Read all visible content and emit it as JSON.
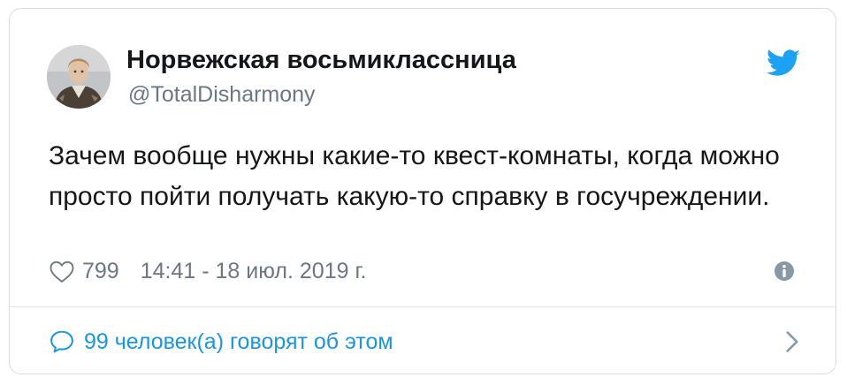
{
  "tweet": {
    "display_name": "Норвежская восьмиклассница",
    "handle": "@TotalDisharmony",
    "text": "Зачем вообще нужны какие-то квест-комнаты, когда можно просто пойти получать какую-то справку в госучреждении.",
    "likes": "799",
    "timestamp": "14:41 - 18 июл. 2019 г.",
    "talking": "99 человек(а) говорят об этом"
  },
  "icons": {
    "brand": "twitter-bird-icon",
    "like": "heart-icon",
    "info": "info-icon",
    "reply": "speech-bubble-icon",
    "more": "chevron-right-icon"
  },
  "colors": {
    "twitter_blue": "#1da1f2",
    "link_blue": "#1b95e0",
    "text": "#14171a",
    "muted": "#697882",
    "border": "#d6dde3"
  }
}
